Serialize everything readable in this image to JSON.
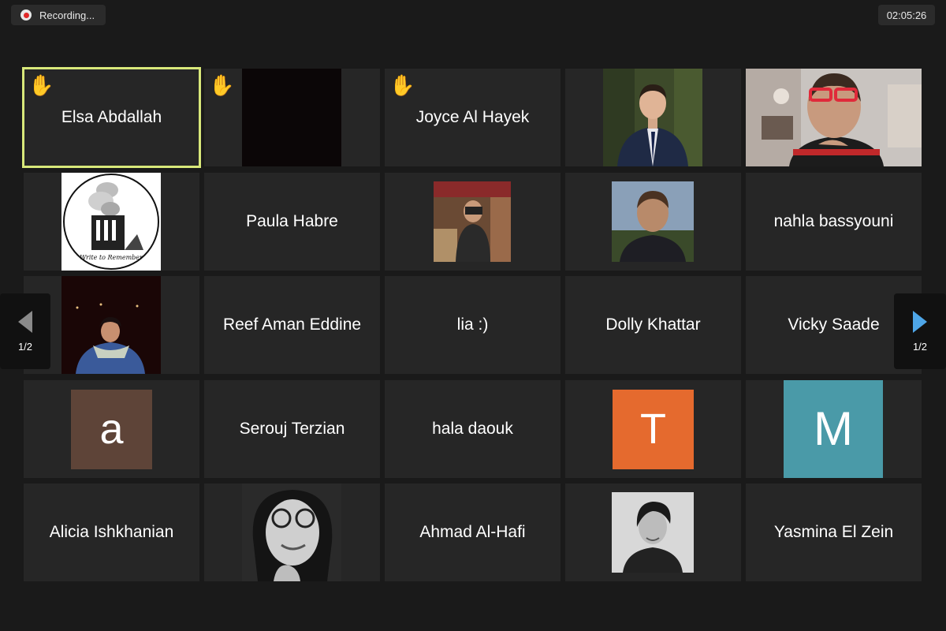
{
  "recording": {
    "label": "Recording...",
    "icon": "record-icon",
    "color": "#e02828"
  },
  "timer": {
    "value": "02:05:26"
  },
  "pagination": {
    "prev_label": "1/2",
    "next_label": "1/2",
    "next_color": "#4ea6e8"
  },
  "participants": [
    {
      "name": "Elsa Abdallah",
      "hand_raised": true,
      "active_speaker": true,
      "active_color": "#d8e87a"
    },
    {
      "name": "",
      "hand_raised": true,
      "media": "video-black"
    },
    {
      "name": "Joyce Al Hayek",
      "hand_raised": true
    },
    {
      "name": "",
      "media": "photo-man-suit"
    },
    {
      "name": "",
      "media": "video-man-red-glasses"
    },
    {
      "name": "",
      "media": "logo-write-to-remember",
      "logo_text": "Write to Remember"
    },
    {
      "name": "Paula Habre"
    },
    {
      "name": "",
      "media": "photo-mirror-selfie"
    },
    {
      "name": "",
      "media": "photo-man-outdoors"
    },
    {
      "name": "nahla bassyouni"
    },
    {
      "name": "",
      "media": "photo-person-night-scarf"
    },
    {
      "name": "Reef Aman Eddine"
    },
    {
      "name": "lia :)"
    },
    {
      "name": "Dolly Khattar"
    },
    {
      "name": "Vicky Saade"
    },
    {
      "name": "",
      "initial": "a",
      "avatar_color": "#5e4438"
    },
    {
      "name": "Serouj Terzian"
    },
    {
      "name": "hala daouk"
    },
    {
      "name": "",
      "initial": "T",
      "avatar_color": "#e56a2e"
    },
    {
      "name": "",
      "initial": "M",
      "avatar_color": "#4a9aa8"
    },
    {
      "name": "Alicia Ishkhanian"
    },
    {
      "name": "",
      "media": "photo-woman-glasses-bw"
    },
    {
      "name": "Ahmad Al-Hafi"
    },
    {
      "name": "",
      "media": "photo-woman-bw-portrait"
    },
    {
      "name": "Yasmina El Zein"
    }
  ]
}
